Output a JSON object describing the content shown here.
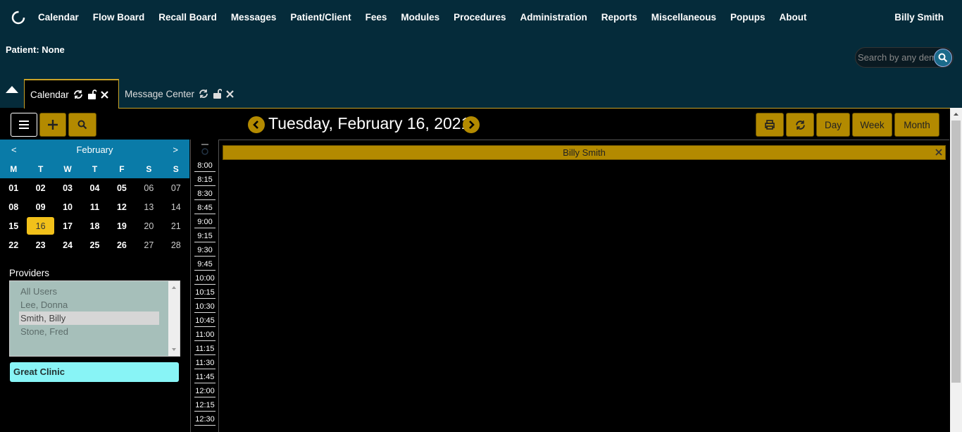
{
  "nav": {
    "items": [
      "Calendar",
      "Flow Board",
      "Recall Board",
      "Messages",
      "Patient/Client",
      "Fees",
      "Modules",
      "Procedures",
      "Administration",
      "Reports",
      "Miscellaneous",
      "Popups",
      "About"
    ],
    "user": "Billy Smith"
  },
  "patient_label": "Patient: None",
  "search": {
    "placeholder": "Search by any demographics"
  },
  "tabs": [
    {
      "label": "Calendar"
    },
    {
      "label": "Message Center"
    }
  ],
  "toolbar": {
    "date_title": "Tuesday, February 16, 2021",
    "day": "Day",
    "week": "Week",
    "month": "Month"
  },
  "mini_calendar": {
    "prev": "<",
    "next": ">",
    "month": "February",
    "dow": [
      "M",
      "T",
      "W",
      "T",
      "F",
      "S",
      "S"
    ],
    "days": [
      "01",
      "02",
      "03",
      "04",
      "05",
      "06",
      "07",
      "08",
      "09",
      "10",
      "11",
      "12",
      "13",
      "14",
      "15",
      "16",
      "17",
      "18",
      "19",
      "20",
      "21",
      "22",
      "23",
      "24",
      "25",
      "26",
      "27",
      "28"
    ],
    "today": "16"
  },
  "providers": {
    "title": "Providers",
    "items": [
      "All Users",
      "Lee, Donna",
      "Smith, Billy",
      "Stone, Fred"
    ],
    "selected": "Smith, Billy"
  },
  "facility": "Great Clinic",
  "schedule": {
    "provider": "Billy Smith",
    "times": [
      "8:00",
      "8:15",
      "8:30",
      "8:45",
      "9:00",
      "9:15",
      "9:30",
      "9:45",
      "10:00",
      "10:15",
      "10:30",
      "10:45",
      "11:00",
      "11:15",
      "11:30",
      "11:45",
      "12:00",
      "12:15",
      "12:30"
    ]
  },
  "colors": {
    "accent": "#b38a00",
    "header": "#052b3a",
    "calendar_head": "#0a7ba8",
    "today": "#f2c11a",
    "facility": "#88f4f6"
  }
}
